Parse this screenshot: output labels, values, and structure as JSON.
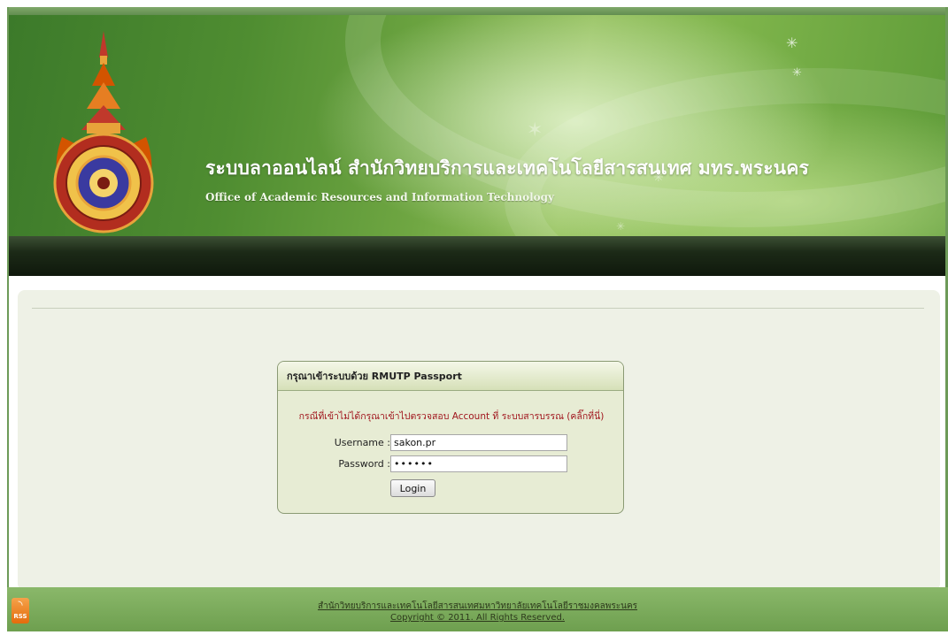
{
  "header": {
    "title": "ระบบลาออนไลน์ สำนักวิทยบริการและเทคโนโลยีสารสนเทศ มทร.พระนคร",
    "subtitle": "Office of Academic Resources and Information Technology",
    "logo_icon": "rmutp-emblem-icon"
  },
  "login": {
    "heading": "กรุณาเข้าระบบด้วย RMUTP Passport",
    "notice": "กรณีที่เข้าไม่ได้กรุณาเข้าไปตรวจสอบ Account ที่ ระบบสารบรรณ (คลิ๊กที่นี่)",
    "username_label": "Username :",
    "username_value": "sakon.pr",
    "password_label": "Password :",
    "password_value": "••••••",
    "login_button": "Login"
  },
  "footer": {
    "rss_label": "RSS",
    "org_link": "สำนักวิทยบริการและเทคโนโลยีสารสนเทศมหาวิทยาลัยเทคโนโลยีราชมงคลพระนคร",
    "copyright": "Copyright © 2011. All Rights Reserved."
  },
  "colors": {
    "banner_green": "#5e9b38",
    "menubar_dark": "#1c2a17",
    "notice_red": "#a0141c",
    "footer_green": "#7aab5c"
  }
}
